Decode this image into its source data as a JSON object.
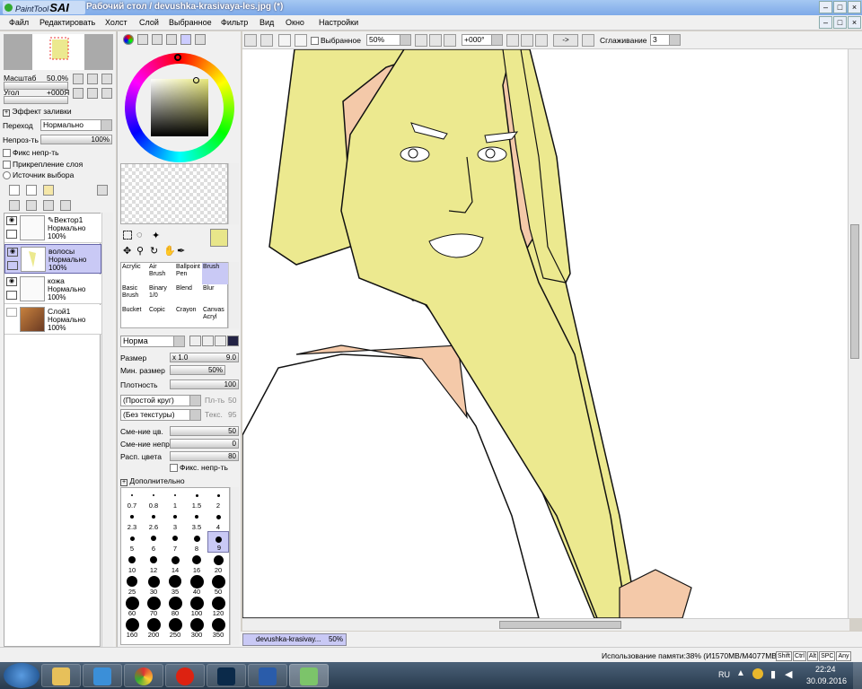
{
  "window": {
    "app_logo_text": "PaintTool",
    "app_logo_bold": "SAI",
    "title": "Рабочий стол / devushka-krasivaya-les.jpg (*)"
  },
  "menu": [
    "Файл",
    "Редактировать",
    "Холст",
    "Слой",
    "Выбранное",
    "Фильтр",
    "Вид",
    "Окно",
    "Настройки"
  ],
  "navigator": {
    "zoom_label": "Масштаб",
    "zoom_value": "50.0%",
    "angle_label": "Угол",
    "angle_value": "+000Я"
  },
  "fill_effect": {
    "header": "Эффект заливки",
    "mode_label": "Переход",
    "mode_value": "Нормально",
    "opacity_label": "Непроз-ть",
    "opacity_value": "100%",
    "preserve_opacity": "Фикс непр-ть",
    "clip_layer": "Прикрепление слоя",
    "selection_source": "Источник выбора"
  },
  "layers": [
    {
      "name": "Вектор1",
      "mode": "Нормально",
      "opacity": "100%"
    },
    {
      "name": "волосы",
      "mode": "Нормально",
      "opacity": "100%",
      "selected": true
    },
    {
      "name": "кожа",
      "mode": "Нормально",
      "opacity": "100%"
    },
    {
      "name": "Слой1",
      "mode": "Нормально",
      "opacity": "100%"
    }
  ],
  "tools": [
    {
      "label": "Acrylic"
    },
    {
      "label": "Air Brush"
    },
    {
      "label": "Ballpoint Pen"
    },
    {
      "label": "Brush",
      "selected": true
    },
    {
      "label": "Basic Brush"
    },
    {
      "label": "Binary 1/0"
    },
    {
      "label": "Blend"
    },
    {
      "label": "Blur"
    },
    {
      "label": "Bucket"
    },
    {
      "label": "Copic"
    },
    {
      "label": "Crayon"
    },
    {
      "label": "Canvas Acryl"
    }
  ],
  "brush": {
    "mode": "Норма",
    "size_label": "Размер",
    "size_mult": "x 1.0",
    "size_value": "9.0",
    "min_size_label": "Мин. размер",
    "min_size_value": "50%",
    "density_label": "Плотность",
    "density_value": "100",
    "shape": "(Простой круг)",
    "shape_strength_label": "Пл-ть",
    "shape_strength": "50",
    "texture": "(Без текстуры)",
    "texture_strength_label": "Текс.",
    "texture_strength": "95",
    "blending_label": "Сме-ние цв.",
    "blending_value": "50",
    "dilution_label": "Сме-ние непр.",
    "dilution_value": "0",
    "persistence_label": "Расп. цвета",
    "persistence_value": "80",
    "keep_opacity": "Фикс. непр-ть",
    "advanced": "Дополнительно"
  },
  "brush_sizes": [
    "0.7",
    "0.8",
    "1",
    "1.5",
    "2",
    "2.3",
    "2.6",
    "3",
    "3.5",
    "4",
    "5",
    "6",
    "7",
    "8",
    "9",
    "10",
    "12",
    "14",
    "16",
    "20",
    "25",
    "30",
    "35",
    "40",
    "50",
    "60",
    "70",
    "80",
    "100",
    "120",
    "160",
    "200",
    "250",
    "300",
    "350"
  ],
  "canvas_toolbar": {
    "selection_label": "Выбранное",
    "zoom": "50%",
    "angle": "+000°",
    "flip": "->",
    "smoothing_label": "Сглаживание",
    "smoothing_value": "3"
  },
  "canvas_tab": {
    "name": "devushka-krasivay...",
    "zoom": "50%"
  },
  "status": {
    "memory": "Использование памяти:38% (И1570MB/M4077MB)",
    "keys": [
      "Shift",
      "Ctrl",
      "Alt",
      "SPC",
      "Any"
    ]
  },
  "taskbar": {
    "language": "RU",
    "time": "22:24",
    "date": "30.09.2016"
  },
  "colors": {
    "hair": "#ece98f",
    "skin": "#f4c9a9",
    "primary": "#e8e68a",
    "selection": "#c9c9f5"
  }
}
